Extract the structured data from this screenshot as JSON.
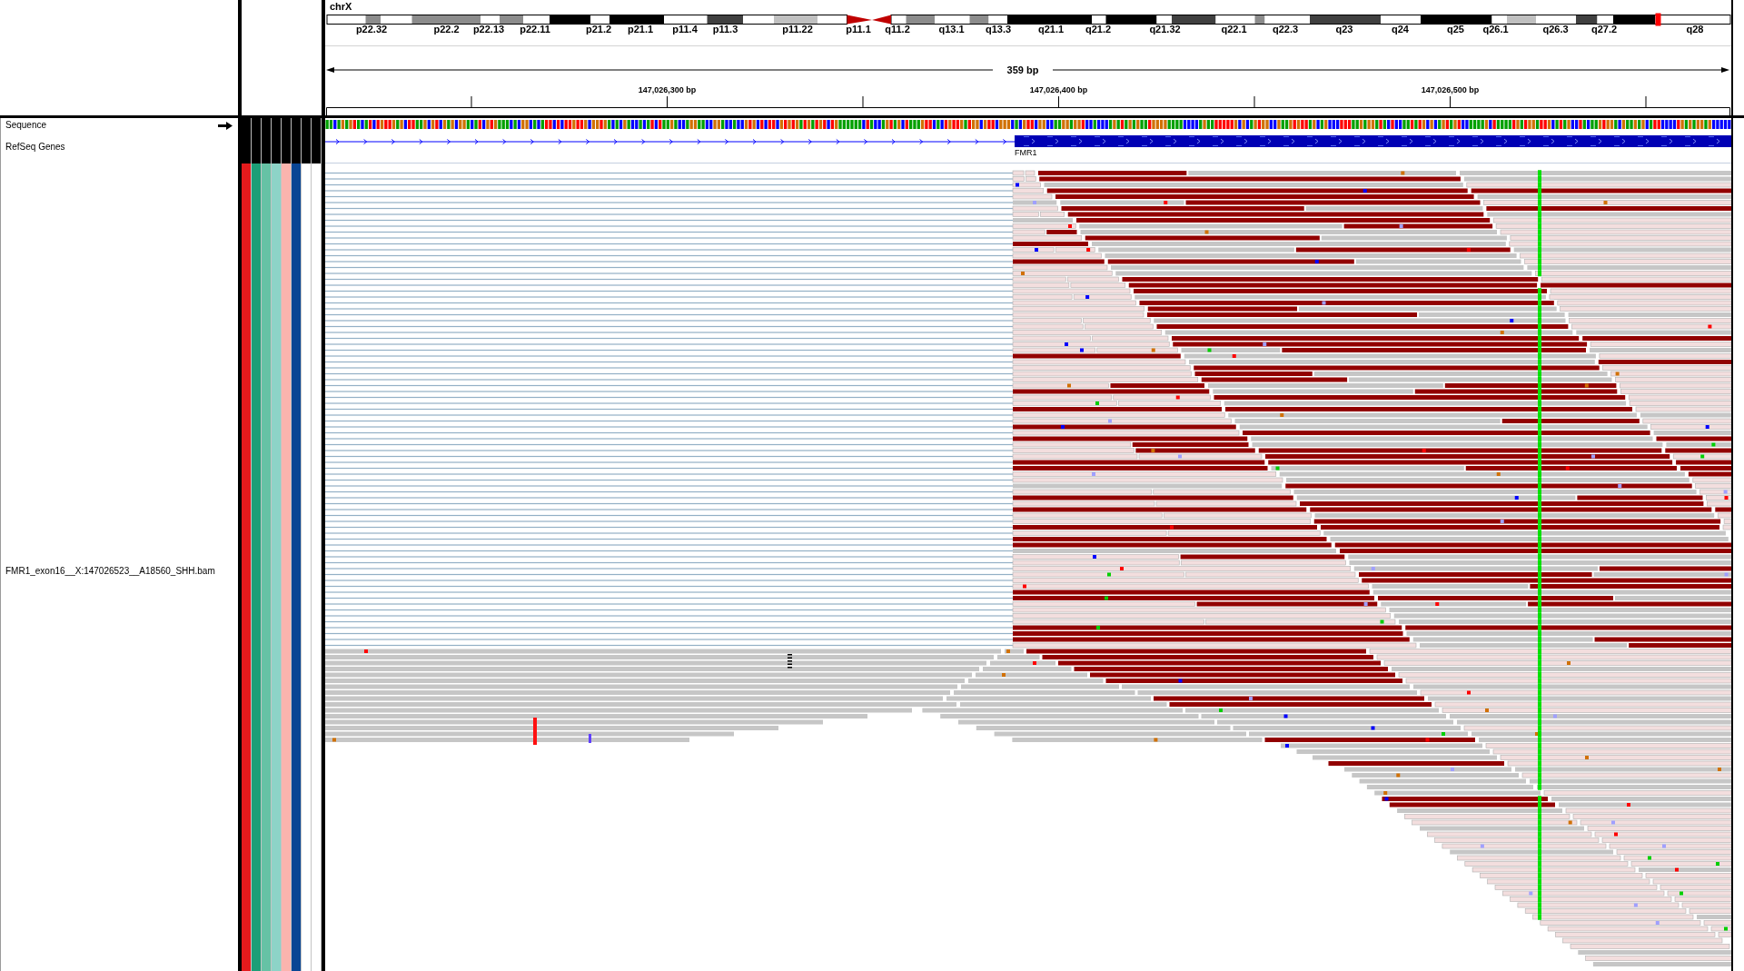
{
  "ideogram": {
    "chromosome": "chrX",
    "bands": [
      "p22.32",
      "p22.2",
      "p22.13",
      "p22.11",
      "p21.2",
      "p21.1",
      "p11.4",
      "p11.3",
      "p11.22",
      "p11.1",
      "q11.2",
      "q13.1",
      "q13.3",
      "q21.1",
      "q21.2",
      "q21.32",
      "q22.1",
      "q22.3",
      "q23",
      "q24",
      "q25",
      "q26.1",
      "q26.3",
      "q27.2",
      "q28"
    ]
  },
  "ruler": {
    "span": "359 bp",
    "ticks": [
      "147,026,300 bp",
      "147,026,400 bp",
      "147,026,500 bp"
    ]
  },
  "tracks": [
    {
      "kind": "sequence",
      "name": "Sequence",
      "forward_strand": true
    },
    {
      "kind": "genes",
      "name": "RefSeq Genes",
      "gene": "FMR1"
    },
    {
      "kind": "alignments",
      "name": "FMR1_exon16__X:147026523__A18560_SHH.bam",
      "attributes": [
        {
          "color": "#e41a1c"
        },
        {
          "color": "#1b9e77"
        },
        {
          "color": "#66c2a5"
        },
        {
          "color": "#8dd3c7"
        },
        {
          "color": "#fbb4ae"
        },
        {
          "color": "#084594"
        },
        {
          "color": "#ffffff"
        },
        {
          "color": "#ffffff"
        }
      ]
    }
  ]
}
